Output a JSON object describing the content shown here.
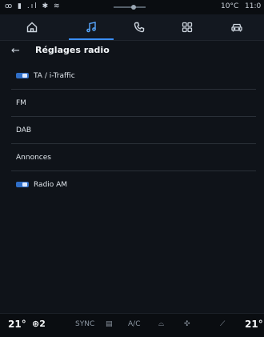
{
  "status": {
    "left": "ꝏ ▮ .ıl ✱ ≋",
    "temp": "10°C",
    "time": "11:0"
  },
  "nav": {
    "tabs": [
      {
        "name": "home-icon",
        "active": false
      },
      {
        "name": "music-icon",
        "active": true
      },
      {
        "name": "phone-icon",
        "active": false
      },
      {
        "name": "apps-icon",
        "active": false
      },
      {
        "name": "car-icon",
        "active": false
      }
    ]
  },
  "header": {
    "title": "Réglages radio"
  },
  "list": {
    "items": [
      {
        "label": "TA / i-Traffic",
        "toggle": true
      },
      {
        "label": "FM",
        "toggle": false
      },
      {
        "label": "DAB",
        "toggle": false
      },
      {
        "label": "Annonces",
        "toggle": false
      },
      {
        "label": "Radio AM",
        "toggle": true
      }
    ]
  },
  "bottom": {
    "left_temp": "21°",
    "seat_level": "2",
    "sync": "SYNC",
    "ac": "A/C",
    "right_temp": "21°"
  },
  "colors": {
    "accent": "#3b8fff",
    "toggle": "#2f6ec7",
    "background": "#0f1319"
  }
}
